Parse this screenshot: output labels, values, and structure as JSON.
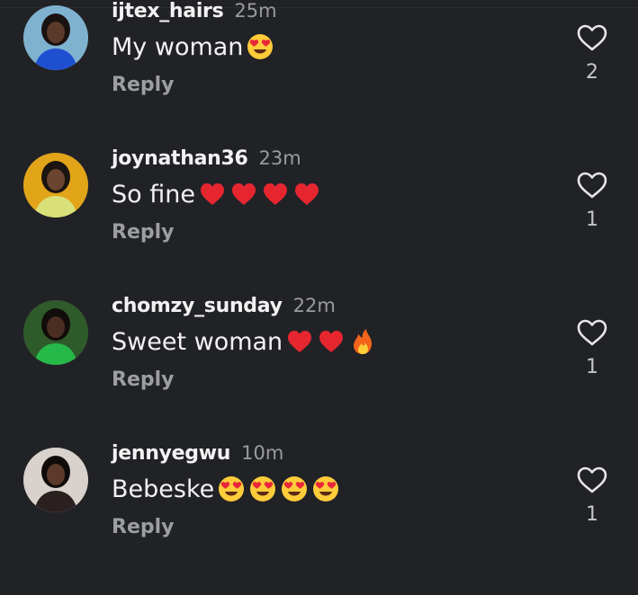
{
  "comments": [
    {
      "username": "ijtex_hairs",
      "time": "25m",
      "text": "My woman",
      "emojis": [
        "heart-eyes"
      ],
      "reply_label": "Reply",
      "like_count": "2",
      "avatar_colors": {
        "bg": "#7fb2cf",
        "skin": "#5a3a2b",
        "outfit": "#1f4fd1",
        "hair": "#1a1111"
      }
    },
    {
      "username": "joynathan36",
      "time": "23m",
      "text": "So fine",
      "emojis": [
        "red-heart",
        "red-heart",
        "red-heart",
        "red-heart"
      ],
      "reply_label": "Reply",
      "like_count": "1",
      "avatar_colors": {
        "bg": "#e2a51a",
        "skin": "#6b4430",
        "outfit": "#d9e07a",
        "hair": "#1b1410"
      }
    },
    {
      "username": "chomzy_sunday",
      "time": "22m",
      "text": "Sweet woman",
      "emojis": [
        "red-heart",
        "red-heart",
        "fire"
      ],
      "reply_label": "Reply",
      "like_count": "1",
      "avatar_colors": {
        "bg": "#2f5a2a",
        "skin": "#4a2e22",
        "outfit": "#27b84a",
        "hair": "#120c0a"
      }
    },
    {
      "username": "jennyegwu",
      "time": "10m",
      "text": "Bebeske",
      "emojis": [
        "heart-eyes",
        "heart-eyes",
        "heart-eyes",
        "heart-eyes"
      ],
      "reply_label": "Reply",
      "like_count": "1",
      "avatar_colors": {
        "bg": "#d9d2cc",
        "skin": "#5b3a2c",
        "outfit": "#2a2020",
        "hair": "#0f0b0a"
      }
    }
  ],
  "colors": {
    "background": "#212226",
    "username": "#f2f2f3",
    "timestamp": "#9a9ba0",
    "reply": "#9d9ea3",
    "heart_outline": "#e6e6e8"
  }
}
